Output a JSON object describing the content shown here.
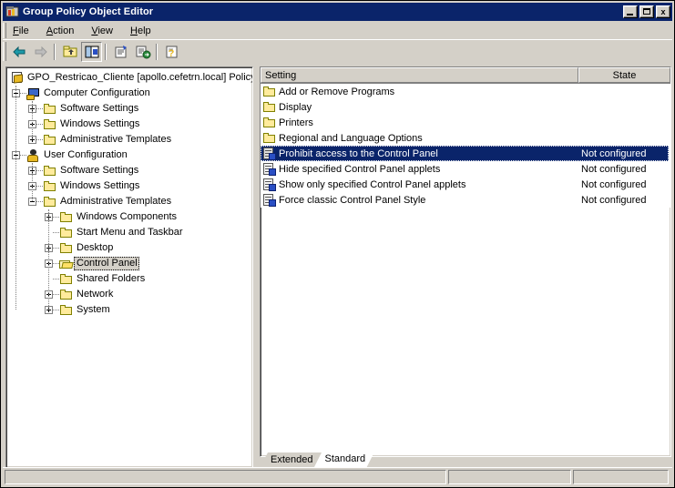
{
  "window": {
    "title": "Group Policy Object Editor",
    "icon": "mmc-console-icon",
    "controls": {
      "minimize": "minimize-button",
      "maximize": "maximize-button",
      "close_label": "x"
    }
  },
  "menubar": {
    "items": [
      {
        "label": "File",
        "accel": "F"
      },
      {
        "label": "Action",
        "accel": "A"
      },
      {
        "label": "View",
        "accel": "V"
      },
      {
        "label": "Help",
        "accel": "H"
      }
    ]
  },
  "toolbar": {
    "buttons": [
      {
        "name": "back-button",
        "icon": "arrow-left-icon",
        "enabled": true
      },
      {
        "name": "forward-button",
        "icon": "arrow-right-icon",
        "enabled": false
      },
      {
        "name": "up-one-level-button",
        "icon": "folder-up-icon",
        "enabled": true
      },
      {
        "name": "show-hide-tree-button",
        "icon": "tree-pane-icon",
        "pressed": true
      },
      {
        "name": "properties-button",
        "icon": "properties-icon",
        "enabled": true
      },
      {
        "name": "export-list-button",
        "icon": "export-list-icon",
        "enabled": true
      },
      {
        "name": "help-button",
        "icon": "help-icon",
        "enabled": true
      }
    ]
  },
  "tree": {
    "nodes": [
      {
        "label": "GPO_Restricao_Cliente [apollo.cefetrn.local] Policy",
        "icon": "gpo-root-icon",
        "level": 0,
        "expander": "none",
        "selected": false
      },
      {
        "label": "Computer Configuration",
        "icon": "computer-configuration-icon",
        "level": 1,
        "expander": "minus",
        "selected": false
      },
      {
        "label": "Software Settings",
        "icon": "folder-icon",
        "level": 2,
        "expander": "plus",
        "selected": false
      },
      {
        "label": "Windows Settings",
        "icon": "folder-icon",
        "level": 2,
        "expander": "plus",
        "selected": false
      },
      {
        "label": "Administrative Templates",
        "icon": "folder-icon",
        "level": 2,
        "expander": "plus",
        "selected": false
      },
      {
        "label": "User Configuration",
        "icon": "user-configuration-icon",
        "level": 1,
        "expander": "minus",
        "selected": false
      },
      {
        "label": "Software Settings",
        "icon": "folder-icon",
        "level": 2,
        "expander": "plus",
        "selected": false
      },
      {
        "label": "Windows Settings",
        "icon": "folder-icon",
        "level": 2,
        "expander": "plus",
        "selected": false
      },
      {
        "label": "Administrative Templates",
        "icon": "folder-icon",
        "level": 2,
        "expander": "minus",
        "selected": false
      },
      {
        "label": "Windows Components",
        "icon": "folder-icon",
        "level": 3,
        "expander": "plus",
        "selected": false
      },
      {
        "label": "Start Menu and Taskbar",
        "icon": "folder-icon",
        "level": 3,
        "expander": "none",
        "selected": false
      },
      {
        "label": "Desktop",
        "icon": "folder-icon",
        "level": 3,
        "expander": "plus",
        "selected": false
      },
      {
        "label": "Control Panel",
        "icon": "folder-open-icon",
        "level": 3,
        "expander": "plus",
        "selected": true
      },
      {
        "label": "Shared Folders",
        "icon": "folder-icon",
        "level": 3,
        "expander": "none",
        "selected": false
      },
      {
        "label": "Network",
        "icon": "folder-icon",
        "level": 3,
        "expander": "plus",
        "selected": false
      },
      {
        "label": "System",
        "icon": "folder-icon",
        "level": 3,
        "expander": "plus",
        "selected": false
      }
    ]
  },
  "list": {
    "columns": [
      {
        "label": "Setting",
        "key": "setting"
      },
      {
        "label": "State",
        "key": "state"
      }
    ],
    "rows": [
      {
        "setting": "Add or Remove Programs",
        "state": "",
        "icon": "folder-icon",
        "selected": false
      },
      {
        "setting": "Display",
        "state": "",
        "icon": "folder-icon",
        "selected": false
      },
      {
        "setting": "Printers",
        "state": "",
        "icon": "folder-icon",
        "selected": false
      },
      {
        "setting": "Regional and Language Options",
        "state": "",
        "icon": "folder-icon",
        "selected": false
      },
      {
        "setting": "Prohibit access to the Control Panel",
        "state": "Not configured",
        "icon": "policy-setting-icon",
        "selected": true
      },
      {
        "setting": "Hide specified Control Panel applets",
        "state": "Not configured",
        "icon": "policy-setting-icon",
        "selected": false
      },
      {
        "setting": "Show only specified Control Panel applets",
        "state": "Not configured",
        "icon": "policy-setting-icon",
        "selected": false
      },
      {
        "setting": "Force classic Control Panel Style",
        "state": "Not configured",
        "icon": "policy-setting-icon",
        "selected": false
      }
    ]
  },
  "tabs": [
    {
      "label": "Extended",
      "active": false
    },
    {
      "label": "Standard",
      "active": true
    }
  ],
  "statusbar": {
    "panes": [
      "",
      "",
      ""
    ]
  },
  "colors": {
    "titlebar": "#0a246a",
    "selection": "#0a246a",
    "face": "#d4d0c8",
    "folder": "#ffeb9c"
  }
}
